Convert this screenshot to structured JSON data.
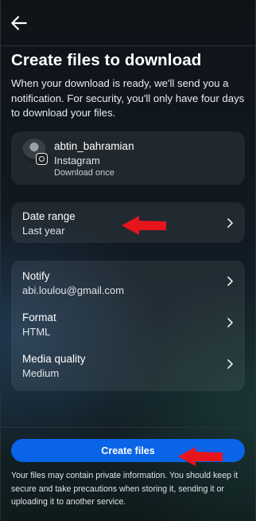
{
  "header": {
    "back_icon": "arrow-left-icon"
  },
  "page": {
    "title": "Create files to download",
    "description": "When your download is ready, we'll send you a notification. For security, you'll only have four days to download your files."
  },
  "account": {
    "username": "abtin_bahramian",
    "platform": "Instagram",
    "note": "Download once",
    "platform_icon": "instagram-icon"
  },
  "date_range": {
    "label": "Date range",
    "value": "Last year"
  },
  "settings": [
    {
      "label": "Notify",
      "value": "abi.loulou@gmail.com"
    },
    {
      "label": "Format",
      "value": "HTML"
    },
    {
      "label": "Media quality",
      "value": "Medium"
    }
  ],
  "cta": {
    "label": "Create files"
  },
  "footnote": "Your files may contain private information. You should keep it secure and take precautions when storing it, sending it or uploading it to another service.",
  "colors": {
    "primary": "#0a64e8",
    "annotation_arrow": "#e8141c"
  }
}
